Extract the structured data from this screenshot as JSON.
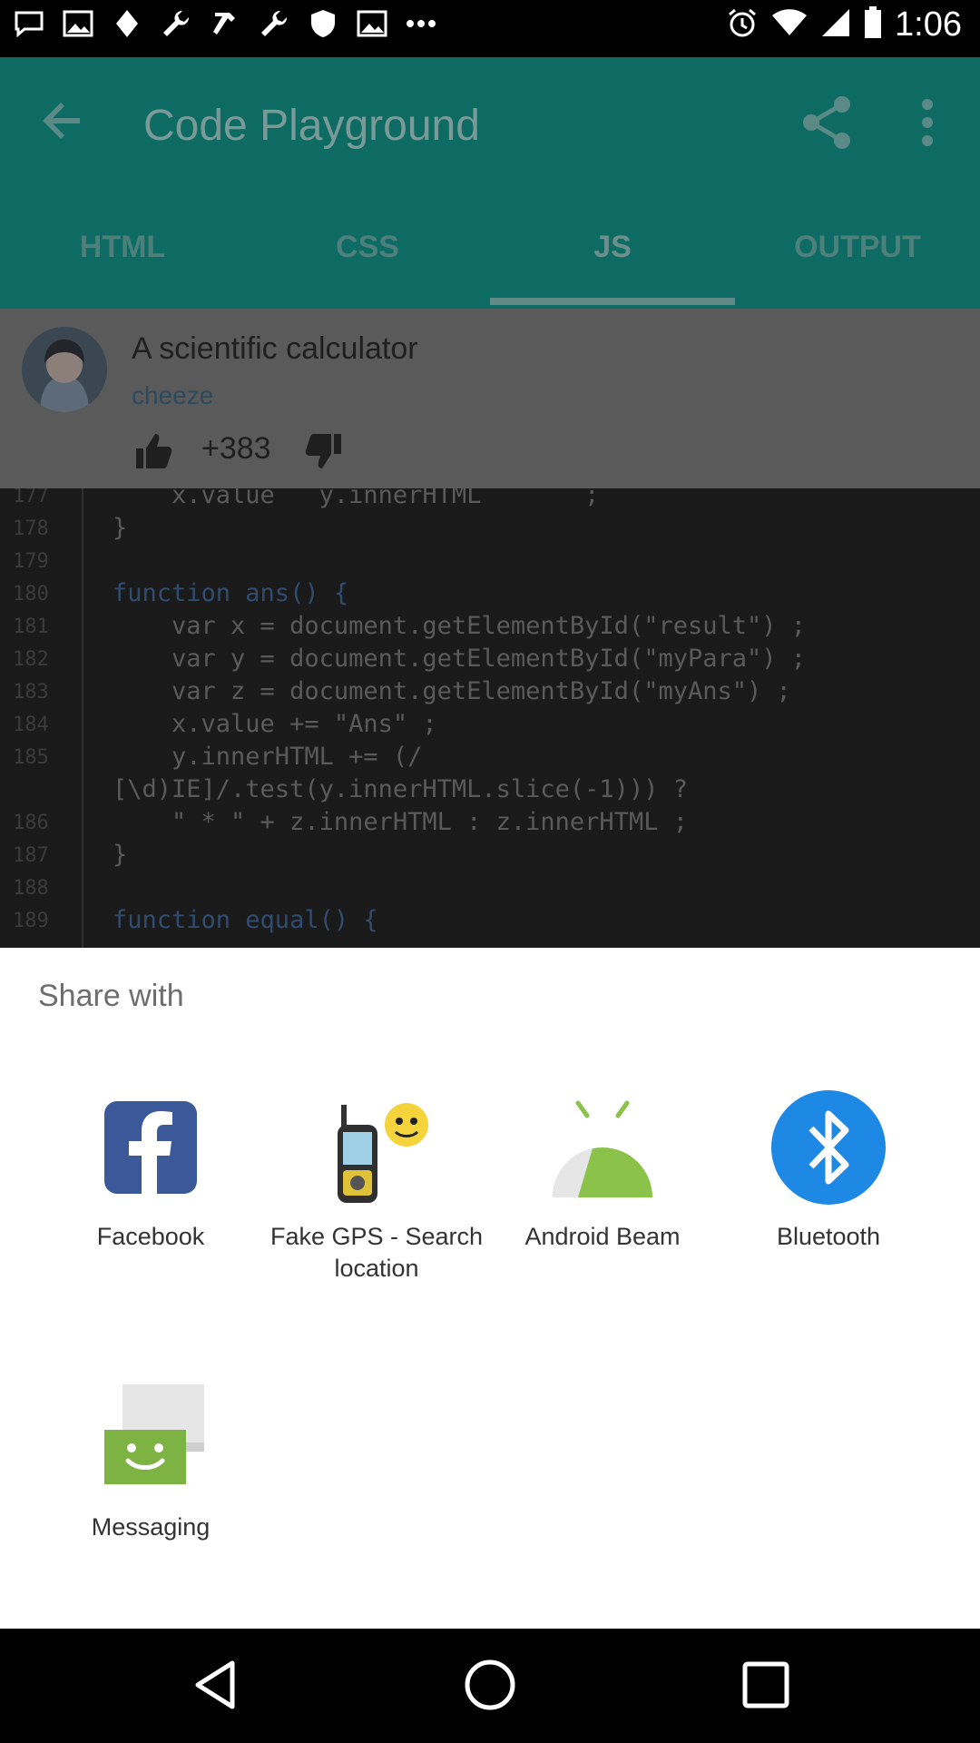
{
  "status_bar": {
    "time": "1:06",
    "left_icons": [
      "chat-icon",
      "image-icon",
      "fiber-icon",
      "wrench-icon",
      "hammer-icon",
      "wrench-icon",
      "shield-icon",
      "image-icon",
      "dots-icon"
    ]
  },
  "app_bar": {
    "title": "Code Playground"
  },
  "tabs": [
    {
      "label": "HTML"
    },
    {
      "label": "CSS"
    },
    {
      "label": "JS"
    },
    {
      "label": "OUTPUT"
    }
  ],
  "post": {
    "title": "A scientific calculator",
    "author": "cheeze",
    "votes": "+383"
  },
  "code": {
    "line_numbers": [
      "177",
      "178",
      "179",
      "180",
      "181",
      "182",
      "183",
      "184",
      "185",
      "186",
      "187",
      "188",
      "189"
    ],
    "lines": [
      "    x.value   y.innerHTML       ;",
      "}",
      "",
      "function ans() {",
      "    var x = document.getElementById(\"result\") ;",
      "    var y = document.getElementById(\"myPara\") ;",
      "    var z = document.getElementById(\"myAns\") ;",
      "    x.value += \"Ans\" ;",
      "    y.innerHTML += (/",
      "[\\d)IE]/.test(y.innerHTML.slice(-1))) ?",
      "    \" * \" + z.innerHTML : z.innerHTML ;",
      "}",
      "",
      "function equal() {"
    ]
  },
  "share_sheet": {
    "title": "Share with",
    "apps": [
      {
        "label": "Facebook",
        "icon": "facebook-icon"
      },
      {
        "label": "Fake GPS - Search location",
        "icon": "gps-device-icon"
      },
      {
        "label": "Android Beam",
        "icon": "android-icon"
      },
      {
        "label": "Bluetooth",
        "icon": "bluetooth-icon"
      },
      {
        "label": "Messaging",
        "icon": "messaging-icon"
      }
    ]
  },
  "colors": {
    "app_bar": "#0e6b63",
    "facebook": "#3b5998",
    "bluetooth": "#1e88e5",
    "android": "#8bc34a",
    "messaging": "#7cb342"
  }
}
